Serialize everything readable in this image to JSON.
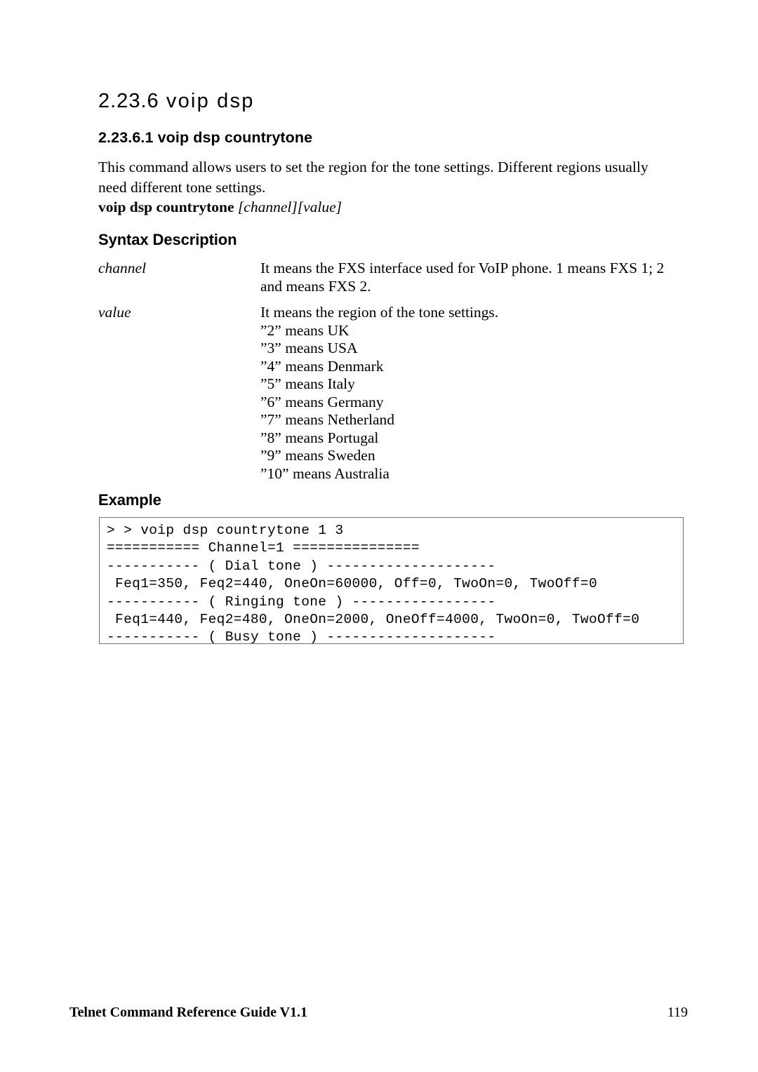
{
  "document": {
    "section_number": "2.23.6",
    "section_title": "voip dsp",
    "subsection_title": "2.23.6.1 voip dsp countrytone",
    "intro_paragraph": "This command allows users to set the region for the tone settings. Different regions usually need different tone settings.",
    "command_syntax": {
      "command": "voip dsp countrytone ",
      "arguments": "[channel][value]"
    },
    "syntax_description": {
      "heading": "Syntax Description",
      "rows": [
        {
          "term": "channel",
          "lines": [
            "It means the FXS interface used for VoIP phone. 1 means FXS 1; 2",
            "and means FXS 2."
          ]
        },
        {
          "term": "value",
          "lines": [
            "It means the region of the tone settings.",
            "”2” means UK",
            "”3” means USA",
            "”4” means Denmark",
            "”5” means Italy",
            "”6” means Germany",
            "”7” means Netherland",
            "”8” means Portugal",
            "”9” means Sweden",
            "”10” means Australia"
          ]
        }
      ]
    },
    "example": {
      "heading": "Example",
      "console_lines": [
        "> > voip dsp countrytone 1 3",
        "=========== Channel=1 ===============",
        "----------- ( Dial tone ) --------------------",
        " Feq1=350, Feq2=440, OneOn=60000, Off=0, TwoOn=0, TwoOff=0",
        "----------- ( Ringing tone ) -----------------",
        " Feq1=440, Feq2=480, OneOn=2000, OneOff=4000, TwoOn=0, TwoOff=0",
        "----------- ( Busy tone ) --------------------"
      ]
    },
    "footer": {
      "left": "Telnet Command Reference Guide V1.1",
      "page_number": "119"
    },
    "colors": {
      "text": "#000000",
      "background": "#ffffff",
      "box_border": "#6f6f6f"
    }
  }
}
